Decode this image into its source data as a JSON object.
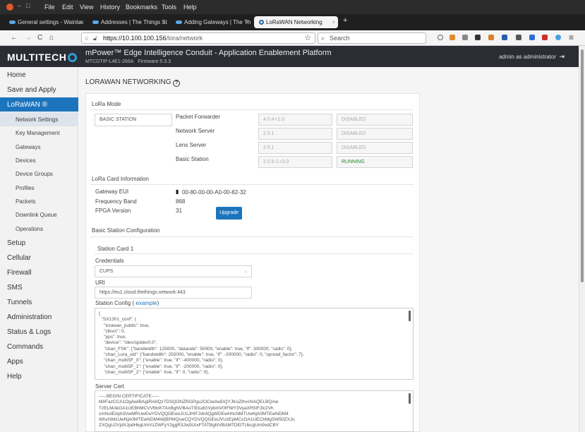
{
  "menubar": {
    "window_min": "–",
    "window_max": "□",
    "items": [
      "File",
      "Edit",
      "View",
      "History",
      "Bookmarks",
      "Tools",
      "Help"
    ]
  },
  "tabs": [
    {
      "label": "General settings - Wainlux",
      "close": "×"
    },
    {
      "label": "Addresses | The Things St",
      "close": "×"
    },
    {
      "label": "Adding Gateways | The Th",
      "close": "×"
    },
    {
      "label": "LoRaWAN Networking",
      "close": "×"
    }
  ],
  "new_tab": "+",
  "nav": {
    "back": "←",
    "forward": "→",
    "reload": "C",
    "home": "⌂",
    "url_host": "https://10.100.100.156",
    "url_path": "/lora/network",
    "star": "☆",
    "search_placeholder": "Search",
    "menu": "≡"
  },
  "header": {
    "logo": "MULTITECH",
    "title": "mPower™ Edge Intelligence Conduit - Application Enablement Platform",
    "model": "MTCDTIP-L4E1-266A",
    "firmware": "Firmware  5.3.3",
    "user": "admin as administrator"
  },
  "sidebar": {
    "home": "Home",
    "save": "Save and Apply",
    "lorawan": "LoRaWAN ®",
    "sub": [
      "Network Settings",
      "Key Management",
      "Gateways",
      "Devices",
      "Device Groups",
      "Profiles",
      "Packets",
      "Downlink Queue",
      "Operations"
    ],
    "rest": [
      "Setup",
      "Cellular",
      "Firewall",
      "SMS",
      "Tunnels",
      "Administration",
      "Status & Logs",
      "Commands",
      "Apps",
      "Help"
    ]
  },
  "page": {
    "title": "LORAWAN NETWORKING",
    "help": "?",
    "lora_mode": {
      "heading": "LoRa Mode",
      "mode": "BASIC STATION",
      "rows": [
        {
          "label": "Packet Forwarder",
          "version": "4.0.4-r1.0",
          "status": "DISABLED"
        },
        {
          "label": "Network Server",
          "version": "2.5.1",
          "status": "DISABLED"
        },
        {
          "label": "Lens Server",
          "version": "2.5.1",
          "status": "DISABLED"
        },
        {
          "label": "Basic Station",
          "version": "2.0.5-1-r3.0",
          "status": "RUNNING"
        }
      ]
    },
    "card_info": {
      "heading": "LoRa Card Information",
      "eui_label": "Gateway EUI",
      "eui": "00-80-00-00-A0-00-82-32",
      "freq_label": "Frequency Band",
      "freq": "868",
      "fpga_label": "FPGA Version",
      "fpga": "31",
      "upgrade": "Upgrade"
    },
    "bs_config": {
      "heading": "Basic Station Configuration",
      "card": "Station Card 1",
      "cred_label": "Credentials",
      "cred_value": "CUPS",
      "uri_label": "URI",
      "uri": "https://eu1.cloud.thethings.network:443",
      "station_label": "Station Config (",
      "example": "example",
      "station_close": ")",
      "station_text": "{\n  \"SX1301_conf\": {\n    \"lorawan_public\": true,\n    \"clksrc\": 0,\n    \"pps\": true,\n    \"device\": \"/dev/spidev0.0\",\n    \"chan_FSK\": {\"bandwidth\": 125000, \"datarate\": 50000, \"enable\": true, \"if\": 300000, \"radio\": 0},\n    \"chan_Lora_std\": {\"bandwidth\": 250000, \"enable\": true, \"if\": -200000, \"radio\": 0, \"spread_factor\": 7},\n    \"chan_multiSF_0\": {\"enable\": true, \"if\": -400000, \"radio\": 0},\n    \"chan_multiSF_1\": {\"enable\": true, \"if\": -200000, \"radio\": 0},\n    \"chan_multiSF_2\": {\"enable\": true, \"if\": 0, \"radio\": 0},",
      "cert_label": "Server Cert",
      "cert_text": "-----BEGIN CERTIFICATE-----\nMIIFazCCA1OgAwIBAgIRAIIQz7DSQONZRGPgu2OCiwAwDQYJKoZIhvcNAQELBQAw\nTzELMAkGA1UEBhMCVVMxKTAnBgNVBAoTIEludGVybmV0IFNlY3VyaXR5IFJlc2Vh\ncmNoIEdyb3VwMRUwEwYDVQQDEwxJU1JHIFJvb3QgWDEwHhcNMTUwNjA0MTEwNDM4\nWhcNMzUwNjA0MTEwNDM4WjBPMQswCQYDVQQGEwJVUzEpMCcGA1UEChMgSW50ZXJu\nZXQgU2VjdXJpdHkgUmVzZWFyY2ggR3JvdXAxFTATBgNVBAMTDElTUkcgUm9vdCBY"
    }
  }
}
